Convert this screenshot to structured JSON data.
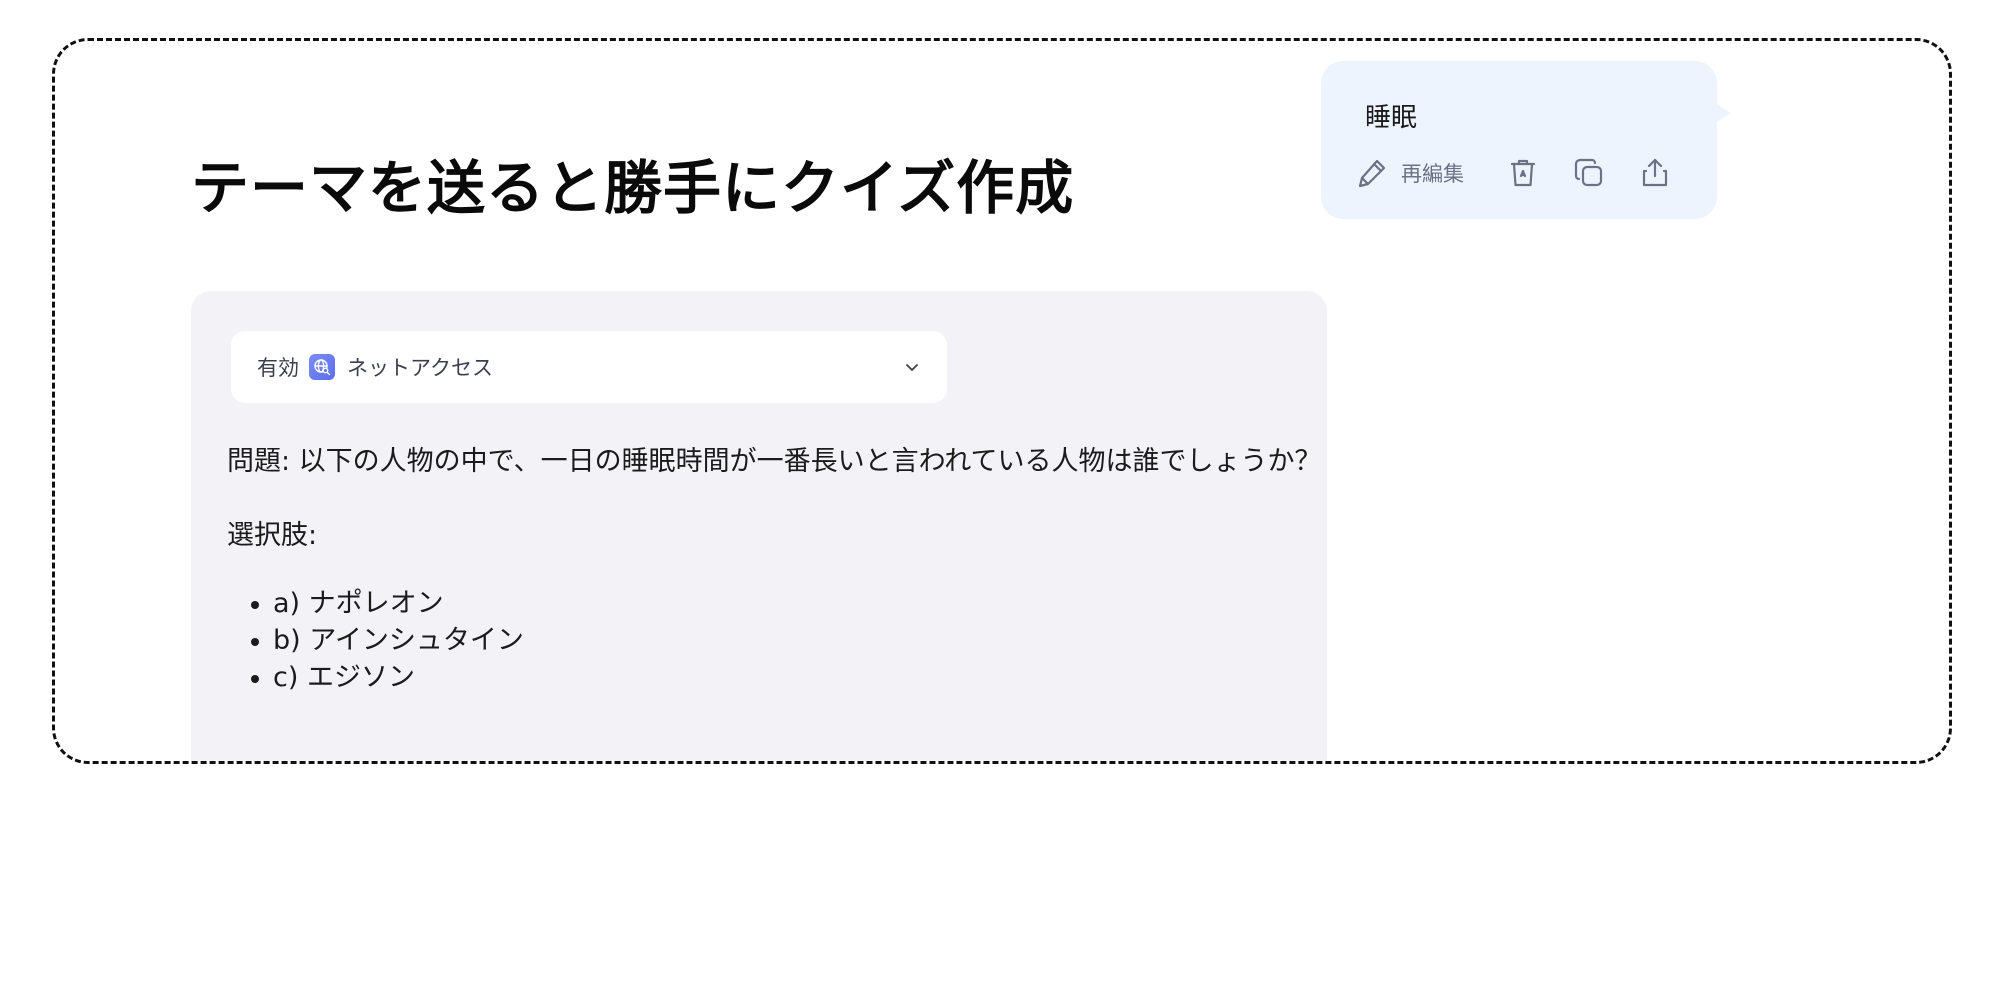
{
  "page": {
    "title": "テーマを送ると勝手にクイズ作成"
  },
  "user_message": {
    "text": "睡眠",
    "actions": {
      "reedit_label": "再編集",
      "reedit_icon": "pencil-icon",
      "delete_icon": "trash-icon",
      "copy_icon": "copy-icon",
      "share_icon": "share-icon"
    }
  },
  "response": {
    "net_access": {
      "status": "有効",
      "label": "ネットアクセス",
      "icon": "globe-search-icon",
      "expand_icon": "chevron-down-icon"
    },
    "question": "問題: 以下の人物の中で、一日の睡眠時間が一番長いと言われている人物は誰でしょうか？",
    "choices_label": "選択肢:",
    "choices": [
      "a) ナポレオン",
      "b) アインシュタイン",
      "c) エジソン"
    ]
  },
  "colors": {
    "user_bubble_bg": "#eef4fe",
    "response_bg": "#f2f2f7",
    "accent_icon": "#5b6ef0",
    "muted_text": "#6b7285"
  }
}
